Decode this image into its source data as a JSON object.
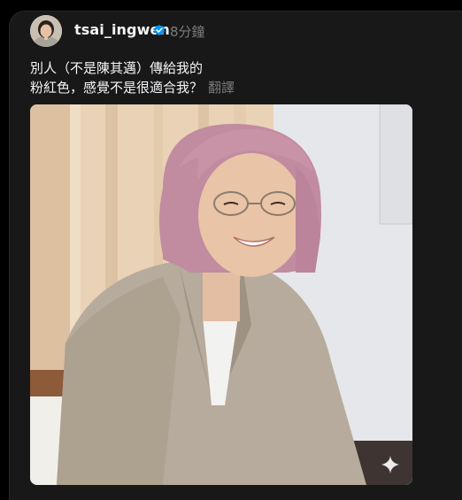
{
  "post": {
    "username": "tsai_ingwen",
    "timestamp": "8分鐘",
    "text_line1": "別人（不是陳其邁）傳給我的",
    "text_line2": "粉紅色，感覺不是很適合我？",
    "translate_label": "翻譯"
  },
  "icons": {
    "verified": "verified-badge-icon",
    "sparkle": "sparkle-icon"
  },
  "colors": {
    "background": "#000000",
    "card": "#181818",
    "text_primary": "#f3f5f7",
    "text_secondary": "#7a7a7a",
    "verified_blue": "#0095f6"
  }
}
